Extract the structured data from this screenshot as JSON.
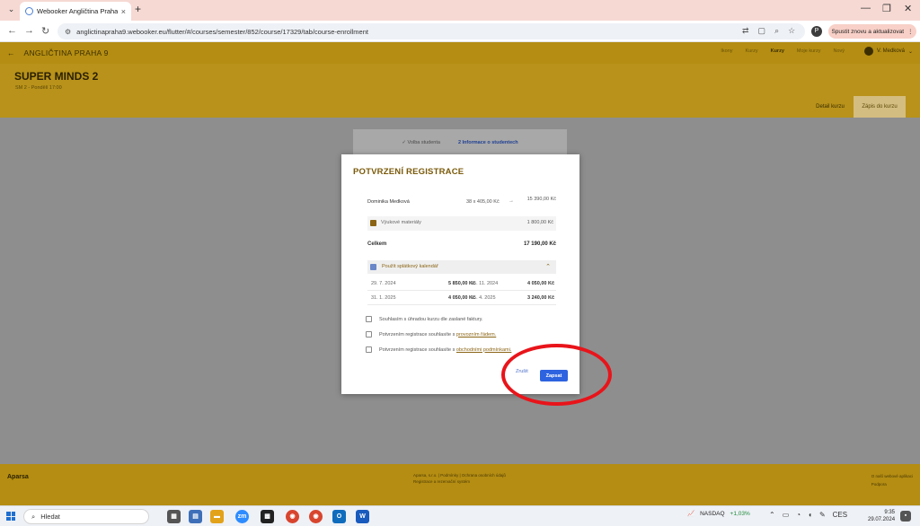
{
  "browser": {
    "tab_title": "Webooker Angličtina Praha 9",
    "url": "anglictinapraha9.webooker.eu/flutter/#/courses/semester/852/course/17329/tab/course-enrollment",
    "update_button": "Spustit znovu a aktualizovat"
  },
  "app": {
    "brand": "ANGLIČTINA PRAHA 9",
    "nav": [
      "Ikony",
      "Kurzy",
      "Kurzy",
      "Moje kurzy",
      "Nový"
    ],
    "user": "V. Medková"
  },
  "course": {
    "title": "SUPER MINDS 2",
    "subtitle": "SM 2 - Pondělí 17:00",
    "tabs": [
      "Detail kurzu",
      "Zápis do kurzu"
    ]
  },
  "wizard": {
    "step1": "✓ Volba studenta",
    "step2": "2  Informace o studentech"
  },
  "modal": {
    "title": "POTVRZENÍ REGISTRACE",
    "student_name": "Dominika Medková",
    "calc": "38 x 405,00 Kč",
    "arrow": "→",
    "student_amount": "15 390,00 Kč",
    "materials_label": "Výukové materiály",
    "materials_amount": "1 800,00 Kč",
    "total_label": "Celkem",
    "total_amount": "17 190,00 Kč",
    "calendar_label": "Použít splátkový kalendář",
    "installments": [
      {
        "date1": "29. 7. 2024",
        "amount1": "5 850,00 Kč",
        "date2": "15. 11. 2024",
        "amount2": "4 050,00 Kč"
      },
      {
        "date1": "31. 1. 2025",
        "amount1": "4 050,00 Kč",
        "date2": "15. 4. 2025",
        "amount2": "3 240,00 Kč"
      }
    ],
    "consents": [
      {
        "text": "Souhlasím s úhradou kurzu dle zaslané faktury.",
        "link": ""
      },
      {
        "text": "Potvrzením registrace souhlasíte s ",
        "link": "provozním řádem."
      },
      {
        "text": "Potvrzením registrace souhlasíte s ",
        "link": "obchodními podmínkami."
      }
    ],
    "cancel": "Zrušit",
    "submit": "Zapsat"
  },
  "footer": {
    "logo": "Aparsa",
    "center_line1": "Aparsa, s.r.o. | Podmínky | Ochrana osobních údajů",
    "center_line2": "Registrace a rezervační systém",
    "right_line1": "O naší webové aplikaci",
    "right_line2": "Podpora"
  },
  "taskbar": {
    "search": "Hledat",
    "stock": "NASDAQ",
    "stock_change": "+1,03%",
    "lang": "CES",
    "time": "9:35",
    "date": "29.07.2024"
  },
  "highlight_color": "#e8141a"
}
